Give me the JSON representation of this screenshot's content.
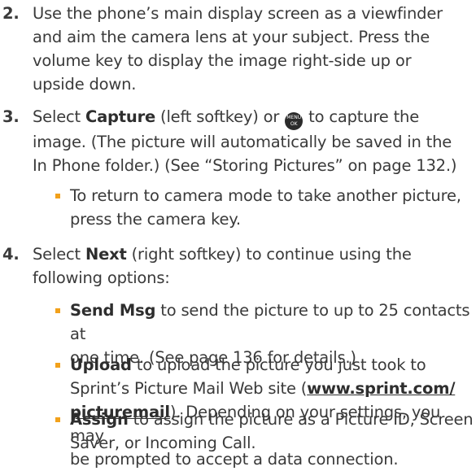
{
  "steps": [
    {
      "number": "2.",
      "lines": [
        "Use the phone’s main display screen as a viewfinder",
        "and aim the camera lens at your subject. Press the",
        "volume key to display the image right-side up or",
        "upside down."
      ]
    },
    {
      "number": "3.",
      "select": "Select ",
      "bold": "Capture",
      "after_bold": " (left softkey) or ",
      "icon_top": "MENU",
      "icon_bottom": "OK",
      "after_icon": " to capture the",
      "lines": [
        "image. (The picture will automatically be saved in the",
        "In Phone folder.) (See “Storing Pictures” on page 132.)"
      ],
      "bullet_lines": [
        "To return to camera mode to take another picture,",
        "press the camera key."
      ]
    },
    {
      "number": "4.",
      "select": "Select ",
      "bold": "Next",
      "after_bold": " (right softkey) to continue using the",
      "line2": "following options:",
      "options": [
        {
          "label": "Send Msg",
          "rest": " to send the picture to up to 25 contacts at",
          "line2": "one time. (See page 136 for details.)"
        },
        {
          "label": "Upload",
          "rest": " to upload the picture you just took to",
          "line2_pre": "Sprint’s Picture Mail Web site (",
          "link1": "www.sprint.com/",
          "link2": "picturemail",
          "line3_post": "). Depending on your settings, you may",
          "line4": "be prompted to accept a data connection."
        },
        {
          "label": "Assign",
          "rest": " to assign the picture as a Picture ID, Screen",
          "line2": "Saver, or Incoming Call."
        }
      ]
    }
  ]
}
